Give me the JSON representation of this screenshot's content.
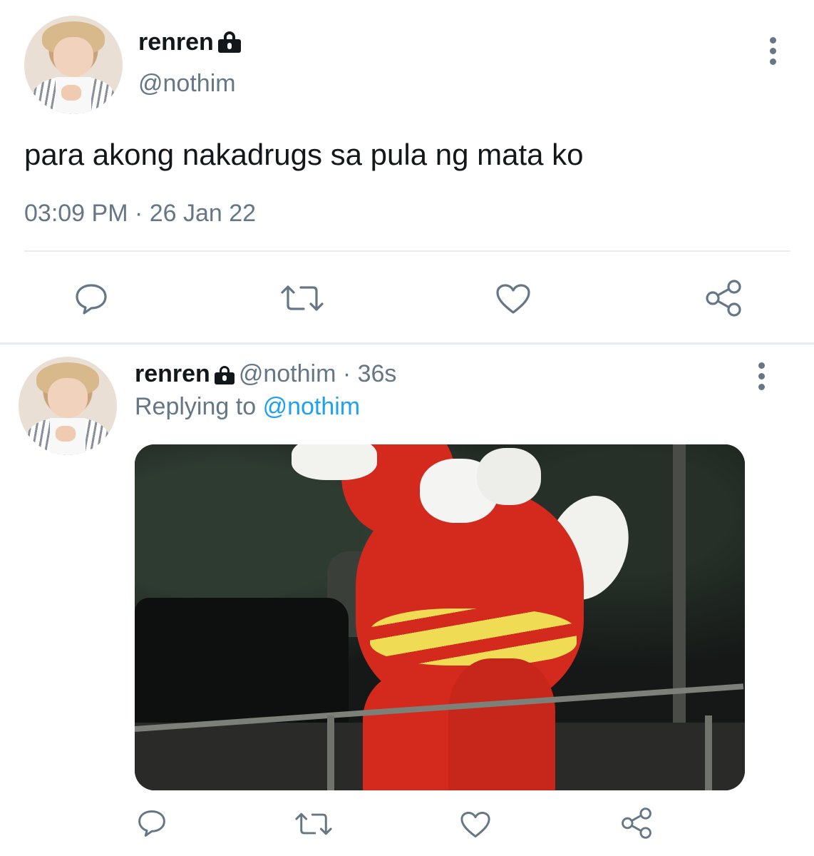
{
  "main_tweet": {
    "display_name": "renren",
    "handle": "@nothim",
    "text": "para akong nakadrugs sa pula ng mata ko",
    "timestamp": "03:09 PM · 26 Jan 22",
    "protected": true,
    "actions": [
      "reply-icon",
      "retweet-icon",
      "like-icon",
      "share-icon"
    ]
  },
  "reply_tweet": {
    "display_name": "renren",
    "handle": "@nothim · 36s",
    "replying_prefix": "Replying to",
    "replying_handle": "@nothim",
    "protected": true,
    "actions": [
      "reply-icon",
      "retweet-icon",
      "like-icon",
      "share-icon"
    ]
  },
  "colors": {
    "text": "#14171a",
    "secondary": "#657786",
    "link": "#1da1f2",
    "divider": "#e6ecf0",
    "icon": "#657786"
  }
}
